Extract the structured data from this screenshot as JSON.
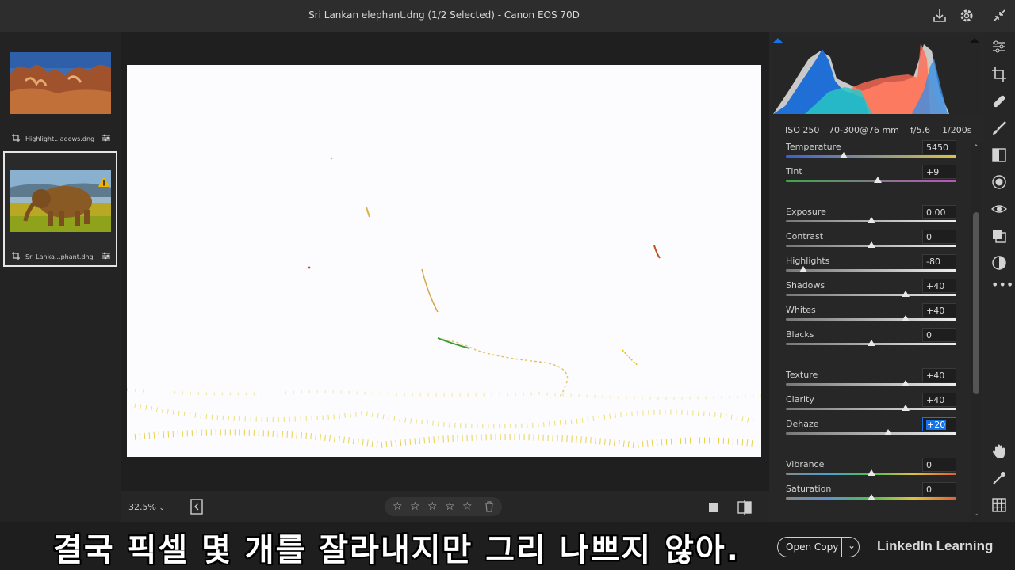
{
  "window": {
    "title": "Sri Lankan elephant.dng (1/2 Selected)  -  Canon EOS 70D"
  },
  "filmstrip": {
    "items": [
      {
        "caption": "Highlight...adows.dng",
        "selected": false,
        "warning": false
      },
      {
        "caption": "Sri Lanka...phant.dng",
        "selected": true,
        "warning": true
      }
    ]
  },
  "histogram": {
    "exif": {
      "iso": "ISO 250",
      "lens": "70-300@76 mm",
      "aperture": "f/5.6",
      "shutter": "1/200s"
    }
  },
  "sliders": [
    {
      "label": "Temperature",
      "value": "5450",
      "level": 0.34,
      "track": "temp",
      "active": false
    },
    {
      "label": "Tint",
      "value": "+9",
      "level": 0.54,
      "track": "tint",
      "active": false
    },
    {
      "label": "Exposure",
      "value": "0.00",
      "level": 0.5,
      "track": "gray",
      "active": false
    },
    {
      "label": "Contrast",
      "value": "0",
      "level": 0.5,
      "track": "gray",
      "active": false
    },
    {
      "label": "Highlights",
      "value": "-80",
      "level": 0.1,
      "track": "gray",
      "active": false
    },
    {
      "label": "Shadows",
      "value": "+40",
      "level": 0.7,
      "track": "gray",
      "active": false
    },
    {
      "label": "Whites",
      "value": "+40",
      "level": 0.7,
      "track": "gray",
      "active": false
    },
    {
      "label": "Blacks",
      "value": "0",
      "level": 0.5,
      "track": "gray",
      "active": false
    },
    {
      "label": "Texture",
      "value": "+40",
      "level": 0.7,
      "track": "gray",
      "active": false
    },
    {
      "label": "Clarity",
      "value": "+40",
      "level": 0.7,
      "track": "gray",
      "active": false
    },
    {
      "label": "Dehaze",
      "value": "+20",
      "level": 0.6,
      "track": "gray",
      "active": true
    },
    {
      "label": "Vibrance",
      "value": "0",
      "level": 0.5,
      "track": "vib",
      "active": false
    },
    {
      "label": "Saturation",
      "value": "0",
      "level": 0.5,
      "track": "sat",
      "active": false
    }
  ],
  "bottom": {
    "zoom": "32.5%",
    "stars": [
      "☆",
      "☆",
      "☆",
      "☆",
      "☆"
    ]
  },
  "footer": {
    "open_copy": "Open Copy",
    "brand": "LinkedIn Learning",
    "subtitle": "결국 픽셀 몇 개를 잘라내지만 그리 나쁘지 않아."
  },
  "colors": {
    "accent": "#1473e6",
    "panel": "#272727",
    "canvas": "#1f1f1f"
  },
  "icons": [
    "export-icon",
    "gear-icon",
    "collapse-icon",
    "edit-sliders-icon",
    "crop-icon",
    "healing-icon",
    "brush-icon",
    "linear-gradient-icon",
    "radial-gradient-icon",
    "red-eye-icon",
    "presets-icon",
    "snapshots-icon",
    "more-icon",
    "hand-icon",
    "sampler-icon",
    "grid-icon",
    "rotate-icon",
    "before-after-icon",
    "compare-icon"
  ]
}
